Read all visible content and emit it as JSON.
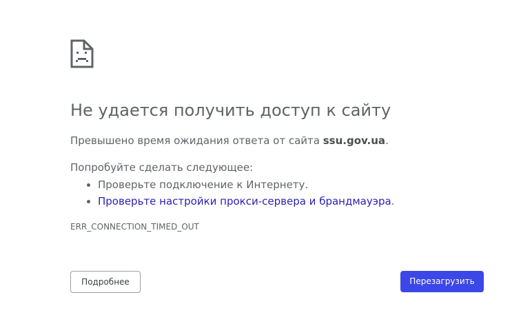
{
  "error": {
    "icon": "sad-page-icon",
    "title": "Не удается получить доступ к сайту",
    "summary_prefix": "Превышено время ожидания ответа от сайта ",
    "site": "ssu.gov.ua",
    "summary_suffix": ".",
    "suggestions_heading": "Попробуйте сделать следующее:",
    "suggestions": [
      {
        "text": "Проверьте подключение к Интернету.",
        "link_text": "",
        "after": ""
      },
      {
        "text": "",
        "link_text": "Проверьте настройки прокси-сервера и брандмауэра",
        "after": "."
      }
    ],
    "code": "ERR_CONNECTION_TIMED_OUT"
  },
  "buttons": {
    "details_label": "Подробнее",
    "reload_label": "Перезагрузить"
  },
  "colors": {
    "link": "#2a1fb5",
    "primary_button": "#3c47e8",
    "text": "#5f6368"
  }
}
